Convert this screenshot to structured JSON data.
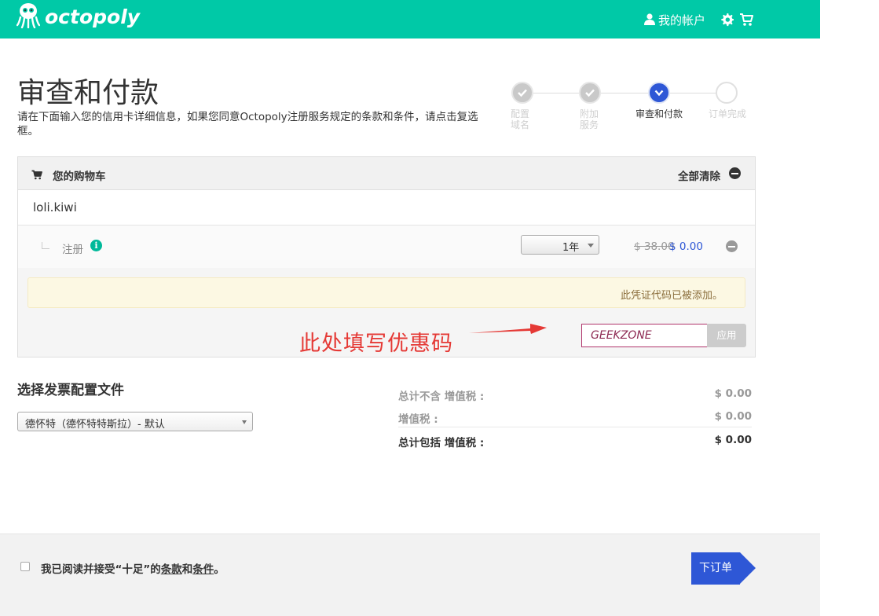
{
  "header": {
    "logo_text": "octopoly",
    "account_label": "我的帐户"
  },
  "page": {
    "title": "审查和付款",
    "description": "请在下面输入您的信用卡详细信息，如果您同意Octopoly注册服务规定的条款和条件，请点击复选框。"
  },
  "steps": [
    {
      "label_line1": "配置",
      "label_line2": "域名",
      "state": "done"
    },
    {
      "label_line1": "附加",
      "label_line2": "服务",
      "state": "done"
    },
    {
      "label_line1": "审查和付款",
      "label_line2": "",
      "state": "active"
    },
    {
      "label_line1": "订单完成",
      "label_line2": "",
      "state": "pending"
    }
  ],
  "cart": {
    "title": "您的购物车",
    "clear_all": "全部清除",
    "domain": "loli.kiwi",
    "item_label": "注册",
    "period": "1年",
    "price_old": "$ 38.00",
    "price_new": "$ 0.00",
    "notice": "此凭证代码已被添加。",
    "promo_annotation": "此处填写优惠码",
    "promo_code": "GEEKZONE",
    "apply_label": "应用"
  },
  "invoice": {
    "title": "选择发票配置文件",
    "selected": "德怀特（德怀特特斯拉）- 默认"
  },
  "summary": [
    {
      "label": "总计不含 增值税 :",
      "value": "$ 0.00"
    },
    {
      "label": "增值税 :",
      "value": "$ 0.00"
    },
    {
      "label": "总计包括 增值税 :",
      "value": "$ 0.00"
    }
  ],
  "footer": {
    "tos_prefix": "我已阅读并接受“十足”的",
    "tos_link1": "条款",
    "tos_and": "和",
    "tos_link2": "条件",
    "tos_suffix": "。",
    "order_button": "下订单"
  },
  "colors": {
    "brand": "#00c9a7",
    "primary": "#2e57d6",
    "annotation": "#e53935"
  }
}
